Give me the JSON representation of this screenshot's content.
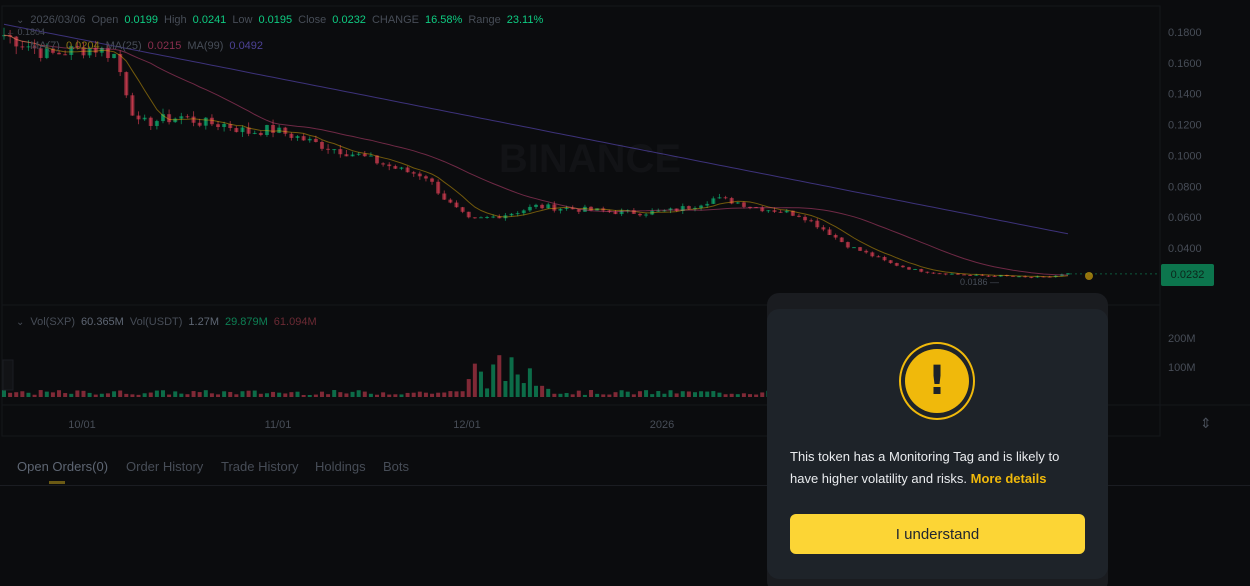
{
  "chart_info": {
    "date": "2026/03/06",
    "open_label": "Open",
    "open": "0.0199",
    "high_label": "High",
    "high": "0.0241",
    "low_label": "Low",
    "low": "0.0195",
    "close_label": "Close",
    "close": "0.0232",
    "change_label": "CHANGE",
    "change": "16.58%",
    "range_label": "Range",
    "range": "23.11%"
  },
  "ma_info": {
    "ma7_label": "MA(7)",
    "ma7": "0.0204",
    "ma25_label": "MA(25)",
    "ma25": "0.0215",
    "ma99_label": "MA(99)",
    "ma99": "0.0492"
  },
  "volume_info": {
    "vol_sxp_label": "Vol(SXP)",
    "vol_sxp": "60.365M",
    "vol_usdt_label": "Vol(USDT)",
    "vol_usdt": "1.27M",
    "v2": "29.879M",
    "v3": "61.094M"
  },
  "price_axis": [
    "0.1800",
    "0.1600",
    "0.1400",
    "0.1200",
    "0.1000",
    "0.0800",
    "0.0600",
    "0.0400"
  ],
  "volume_axis": [
    "200M",
    "100M"
  ],
  "date_axis": [
    "10/01",
    "11/01",
    "12/01",
    "2026"
  ],
  "current_price": "0.0232",
  "high_marker": "0.1804",
  "low_marker": "0.0186",
  "watermark": "BINANCE",
  "tabs": [
    {
      "label": "Open Orders(0)"
    },
    {
      "label": "Order History"
    },
    {
      "label": "Trade History"
    },
    {
      "label": "Holdings"
    },
    {
      "label": "Bots"
    }
  ],
  "modal": {
    "message": "This token has a Monitoring Tag and is likely to have higher volatility and risks.",
    "link": "More details",
    "button": "I understand"
  },
  "colors": {
    "up": "#0ecb81",
    "down": "#f6465d",
    "ma7": "#f0b90b",
    "ma25": "#e84d8a",
    "ma99": "#7b61ff",
    "accent": "#fcd535"
  },
  "chart_data": {
    "type": "candlestick",
    "price_range": [
      0.0186,
      0.1804
    ],
    "close_trend": [
      0.178,
      0.172,
      0.165,
      0.168,
      0.17,
      0.165,
      0.12,
      0.123,
      0.125,
      0.121,
      0.12,
      0.115,
      0.117,
      0.113,
      0.108,
      0.104,
      0.1,
      0.095,
      0.09,
      0.087,
      0.07,
      0.058,
      0.06,
      0.063,
      0.067,
      0.066,
      0.065,
      0.064,
      0.063,
      0.063,
      0.064,
      0.067,
      0.072,
      0.07,
      0.066,
      0.064,
      0.061,
      0.052,
      0.042,
      0.036,
      0.03,
      0.026,
      0.024,
      0.023,
      0.022,
      0.022,
      0.021,
      0.021,
      0.0232
    ]
  }
}
